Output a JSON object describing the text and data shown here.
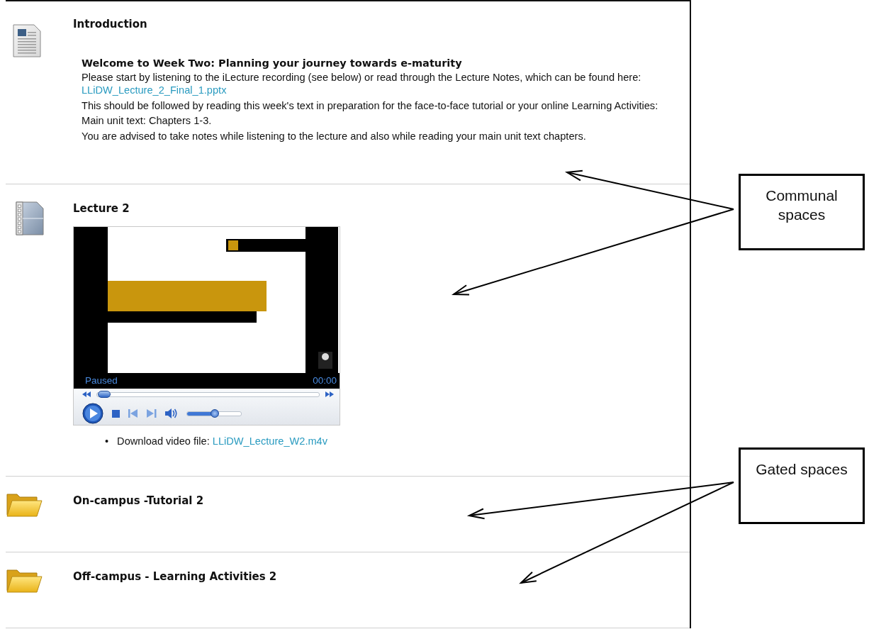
{
  "sections": [
    {
      "kind": "document",
      "title": "Introduction",
      "heading": "Welcome to Week Two: Planning your journey towards e-maturity",
      "paragraphs": [
        {
          "text": "Please start by listening to the iLecture recording (see below) or read through the Lecture Notes, which can be found here:",
          "link": "LLiDW_Lecture_2_Final_1.pptx"
        },
        {
          "text": "This should be followed by reading this week's text in preparation for the face-to-face tutorial or your online Learning Activities:"
        },
        {
          "text": "Main unit text: Chapters 1-3."
        },
        {
          "text": "You are advised to take notes while listening to the lecture and also while reading your main unit text chapters."
        }
      ]
    },
    {
      "kind": "video",
      "title": "Lecture 2",
      "player": {
        "status": "Paused",
        "time": "00:00",
        "seek": {
          "level": 0.03
        },
        "volume": {
          "level": 0.5
        }
      },
      "bullets": [
        {
          "marker": "•",
          "text": "Download video file:",
          "link": "LLiDW_Lecture_W2.m4v"
        }
      ]
    },
    {
      "kind": "folder",
      "title": "On-campus -Tutorial 2"
    },
    {
      "kind": "folder",
      "title": "Off-campus - Learning Activities 2"
    }
  ],
  "callouts": [
    {
      "label": "Communal spaces"
    },
    {
      "label": "Gated spaces"
    }
  ]
}
